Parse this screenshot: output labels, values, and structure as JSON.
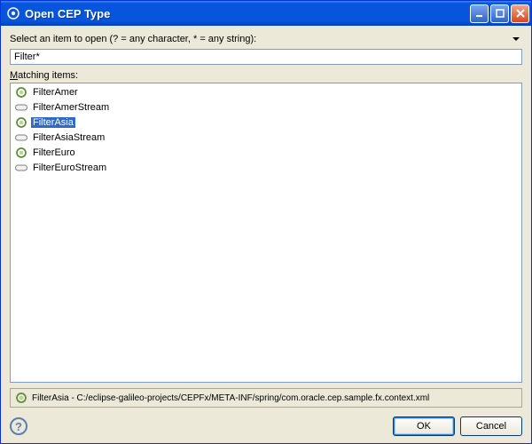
{
  "titlebar": {
    "title": "Open CEP Type"
  },
  "prompt": {
    "label": "Select an item to open (? = any character, * = any string):"
  },
  "search": {
    "value": "Filter*"
  },
  "matching": {
    "label_prefix": "M",
    "label_rest": "atching items:",
    "items": [
      {
        "label": "FilterAmer",
        "icon": "gear",
        "selected": false
      },
      {
        "label": "FilterAmerStream",
        "icon": "stream",
        "selected": false
      },
      {
        "label": "FilterAsia",
        "icon": "gear",
        "selected": true
      },
      {
        "label": "FilterAsiaStream",
        "icon": "stream",
        "selected": false
      },
      {
        "label": "FilterEuro",
        "icon": "gear",
        "selected": false
      },
      {
        "label": "FilterEuroStream",
        "icon": "stream",
        "selected": false
      }
    ]
  },
  "status": {
    "icon": "gear",
    "text": "FilterAsia - C:/eclipse-galileo-projects/CEPFx/META-INF/spring/com.oracle.cep.sample.fx.context.xml"
  },
  "buttons": {
    "ok": "OK",
    "cancel": "Cancel"
  },
  "help_char": "?"
}
